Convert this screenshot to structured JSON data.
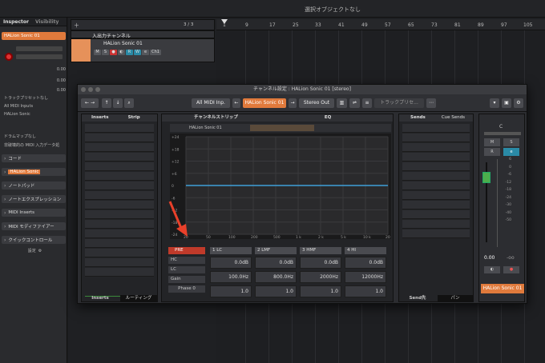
{
  "statusbar": {
    "text": "選択オブジェクトなし"
  },
  "inspector": {
    "tab_inspector": "Inspector",
    "tab_visibility": "Visibility",
    "track_name": "HALion Sonic 01",
    "val1": "0.00",
    "val2": "0.00",
    "val3": "0.00",
    "preset": "トラックプリセットなし",
    "midi_in": "All MIDI Inputs",
    "out": "HALion Sonic",
    "drummap": "ドラムマップなし",
    "note": "非破壊的の MIDI 入力データ処",
    "sections": [
      "コード",
      "HALion Sonic",
      "ノートパッド",
      "ノートエクスプレッション",
      "MIDI Inserts",
      "MIDI モディファイアー",
      "クイックコントロール"
    ],
    "settings": "設定"
  },
  "tracklist": {
    "count": "3 / 3",
    "folder": "入出力チャンネル",
    "track": "HALion Sonic 01",
    "ch": "Ch1"
  },
  "ruler": [
    "1",
    "9",
    "17",
    "25",
    "33",
    "41",
    "49",
    "57",
    "65",
    "73",
    "81",
    "89",
    "97",
    "105"
  ],
  "window": {
    "title": "チャンネル設定 : HALion Sonic 01 [stereo]",
    "input": "All MIDI Inp.",
    "channel": "HALion Sonic 01",
    "output": "Stereo Out",
    "preset": "トラックプリセ...",
    "tab_inserts": "Inserts",
    "tab_strip": "Strip",
    "tab_channelstrip": "チャンネルストリップ",
    "tab_eq": "EQ",
    "tab_sends": "Sends",
    "tab_cue": "Cue Sends",
    "eq_name": "HALion Sonic 01",
    "db_labels": [
      "+24",
      "+18",
      "+12",
      "+6",
      "0",
      "-6",
      "-12",
      "-18",
      "-24"
    ],
    "freq_labels": [
      "20",
      "50",
      "100",
      "200",
      "500",
      "1 k",
      "2 k",
      "5 k",
      "10 k",
      "20 k"
    ],
    "pre": "PRE",
    "hc": "HC",
    "lc": "LC",
    "gain": "Gain",
    "phase": "Phase 0",
    "bands": [
      {
        "name": "1 LC",
        "gain": "0.0dB",
        "freq": "100.0Hz",
        "q": "1.0"
      },
      {
        "name": "2 LMF",
        "gain": "0.0dB",
        "freq": "800.0Hz",
        "q": "1.0"
      },
      {
        "name": "3 HMF",
        "gain": "0.0dB",
        "freq": "2000Hz",
        "q": "1.0"
      },
      {
        "name": "4 HI",
        "gain": "0.0dB",
        "freq": "12000Hz",
        "q": "1.0"
      }
    ],
    "bottom_inserts": "Inserts",
    "bottom_routing": "ルーティング",
    "bottom_sendpre": "Send先",
    "bottom_pan": "パン",
    "fader_val": "0.00",
    "fader_inf": "-oo",
    "fader_name": "HALion Sonic 01",
    "pan": "C",
    "fader_scale": [
      "6",
      "0",
      "-6",
      "-12",
      "-18",
      "-24",
      "-30",
      "-40",
      "-50"
    ]
  },
  "colors": {
    "accent": "#e07a3c",
    "eqline": "#3ea0d8",
    "arrow": "#e8402a"
  }
}
